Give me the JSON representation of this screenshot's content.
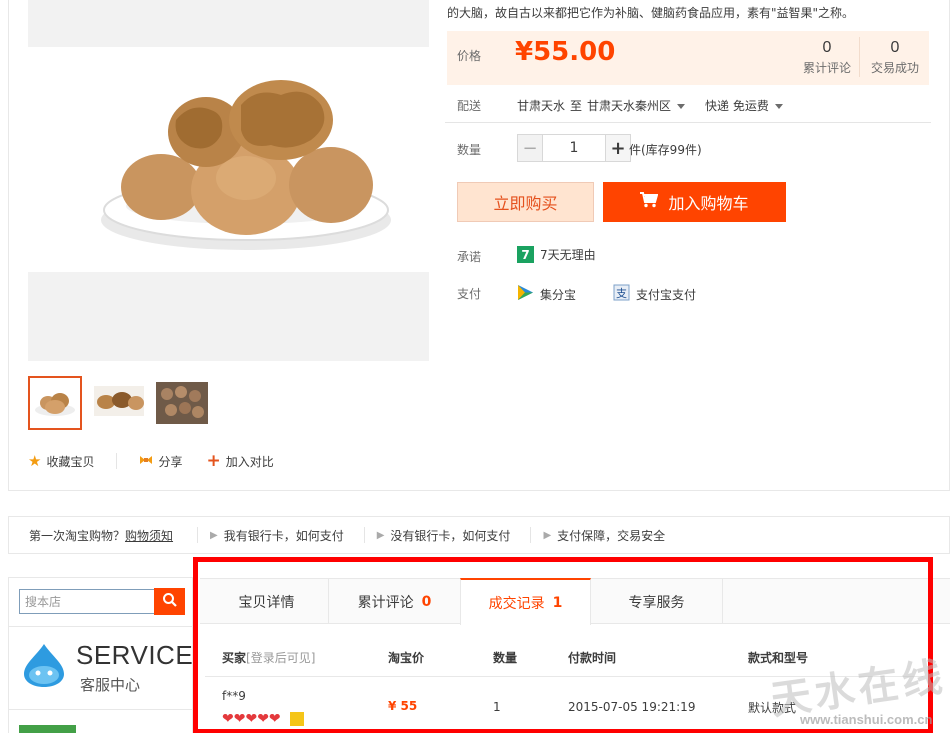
{
  "product": {
    "description_tail": "的大脑，故自古以来都把它作为补脑、健脑药食品应用，素有\"益智果\"之称。",
    "price_label": "价格",
    "price": "¥55.00",
    "reviews_count": "0",
    "reviews_label": "累计评论",
    "sales_count": "0",
    "sales_label": "交易成功",
    "ship_label": "配送",
    "ship_from": "甘肃天水",
    "ship_to_word": "至",
    "ship_to": "甘肃天水秦州区",
    "ship_method": "快递 免运费",
    "qty_label": "数量",
    "qty_minus": "−",
    "qty_value": "1",
    "qty_plus": "+",
    "stock": "件(库存99件)",
    "buy_now": "立即购买",
    "add_cart": "加入购物车",
    "promise_label": "承诺",
    "promise_badge": "7",
    "promise_text": "7天无理由",
    "pay_label": "支付",
    "pay_jifenbao": "集分宝",
    "pay_alipay": "支付宝支付"
  },
  "gallery_actions": {
    "favorite": "收藏宝贝",
    "share": "分享",
    "compare": "加入对比"
  },
  "help_bar": {
    "first": "第一次淘宝购物？",
    "first_link": "购物须知",
    "items": [
      "我有银行卡，如何支付",
      "没有银行卡，如何支付",
      "支付保障，交易安全"
    ]
  },
  "sidebar": {
    "search_placeholder": "搜本店",
    "service_title": "SERVICE",
    "service_sub": "客服中心"
  },
  "tabs": {
    "detail": "宝贝详情",
    "reviews": "累计评论",
    "reviews_count": "0",
    "records": "成交记录",
    "records_count": "1",
    "service": "专享服务"
  },
  "records": {
    "headers": {
      "buyer": "买家",
      "buyer_hint": "[登录后可见]",
      "price": "淘宝价",
      "qty": "数量",
      "time": "付款时间",
      "model": "款式和型号"
    },
    "rows": [
      {
        "buyer": "f**9",
        "price": "¥ 55",
        "qty": "1",
        "time": "2015-07-05 19:21:19",
        "model": "默认款式"
      }
    ]
  },
  "watermark": {
    "text": "天水在线",
    "url": "www.tianshui.com.cn"
  },
  "colors": {
    "accent": "#ff4400",
    "price_bg": "#fff2e8",
    "highlight_box": "#ff0000"
  }
}
